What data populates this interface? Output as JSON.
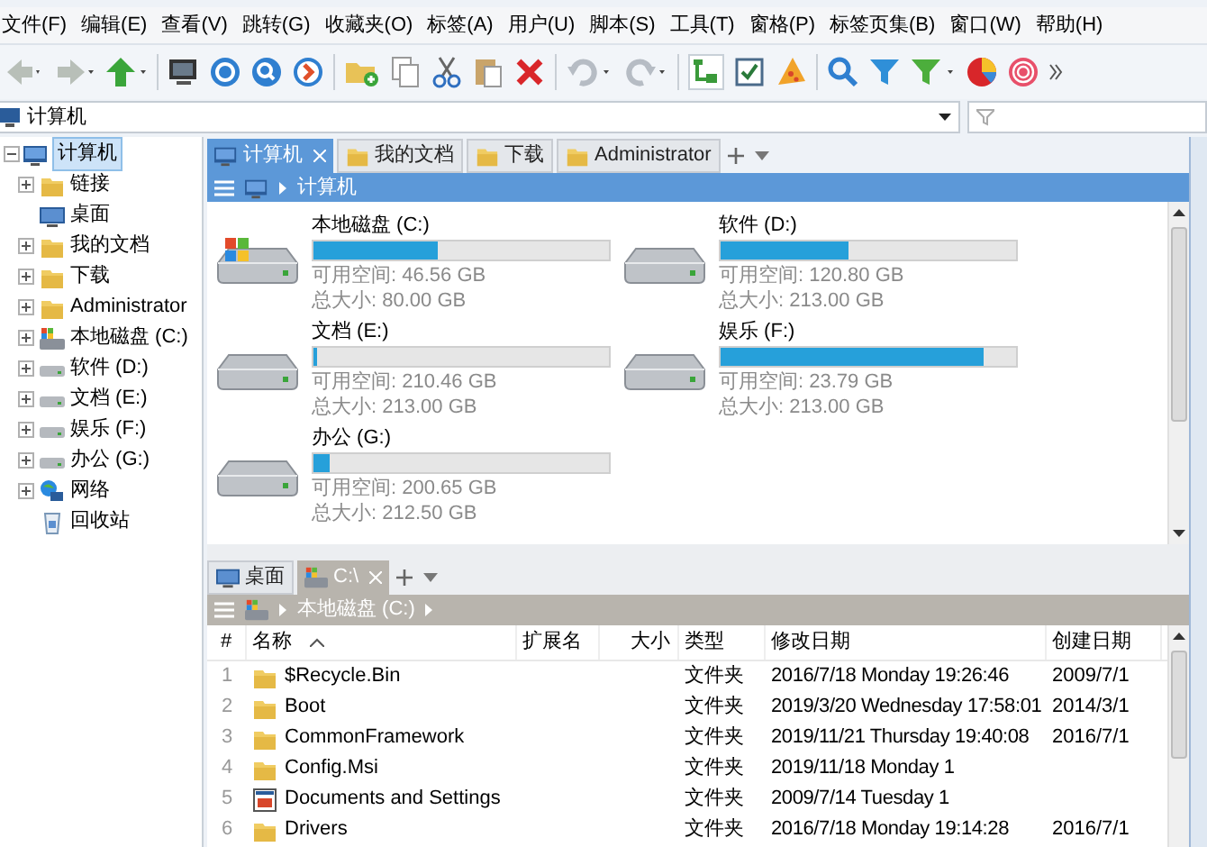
{
  "menu": [
    "文件(F)",
    "编辑(E)",
    "查看(V)",
    "跳转(G)",
    "收藏夹(O)",
    "标签(A)",
    "用户(U)",
    "脚本(S)",
    "工具(T)",
    "窗格(P)",
    "标签页集(B)",
    "窗口(W)",
    "帮助(H)"
  ],
  "address": {
    "value": "计算机"
  },
  "tree": {
    "label": "计算机",
    "selected": true,
    "expanded": true,
    "children": [
      {
        "label": "链接",
        "kind": "folder",
        "expandable": true
      },
      {
        "label": "桌面",
        "kind": "desktop",
        "expandable": false
      },
      {
        "label": "我的文档",
        "kind": "folder",
        "expandable": true
      },
      {
        "label": "下载",
        "kind": "folder",
        "expandable": true
      },
      {
        "label": "Administrator",
        "kind": "folder",
        "expandable": true
      },
      {
        "label": "本地磁盘 (C:)",
        "kind": "sysdrive",
        "expandable": true
      },
      {
        "label": "软件 (D:)",
        "kind": "drive",
        "expandable": true
      },
      {
        "label": "文档 (E:)",
        "kind": "drive",
        "expandable": true
      },
      {
        "label": "娱乐 (F:)",
        "kind": "drive",
        "expandable": true
      },
      {
        "label": "办公 (G:)",
        "kind": "drive",
        "expandable": true
      },
      {
        "label": "网络",
        "kind": "network",
        "expandable": true
      },
      {
        "label": "回收站",
        "kind": "bin",
        "expandable": false
      }
    ]
  },
  "top_pane": {
    "tabs": [
      {
        "label": "计算机",
        "kind": "computer",
        "selected": true
      },
      {
        "label": "我的文档",
        "kind": "folder",
        "selected": false
      },
      {
        "label": "下载",
        "kind": "folder",
        "selected": false
      },
      {
        "label": "Administrator",
        "kind": "folder",
        "selected": false
      }
    ],
    "breadcrumb": [
      "计算机"
    ],
    "drives": [
      {
        "name": "本地磁盘 (C:)",
        "kind": "sysdrive",
        "level": 0.42,
        "free": "可用空间: 46.56 GB",
        "total": "总大小: 80.00 GB"
      },
      {
        "name": "软件 (D:)",
        "kind": "drive",
        "level": 0.43,
        "free": "可用空间: 120.80 GB",
        "total": "总大小: 213.00 GB"
      },
      {
        "name": "文档 (E:)",
        "kind": "drive",
        "level": 0.012,
        "free": "可用空间: 210.46 GB",
        "total": "总大小: 213.00 GB"
      },
      {
        "name": "娱乐 (F:)",
        "kind": "drive",
        "level": 0.89,
        "free": "可用空间: 23.79 GB",
        "total": "总大小: 213.00 GB"
      },
      {
        "name": "办公 (G:)",
        "kind": "drive",
        "level": 0.056,
        "free": "可用空间: 200.65 GB",
        "total": "总大小: 212.50 GB"
      }
    ]
  },
  "bottom_pane": {
    "tabs": [
      {
        "label": "桌面",
        "kind": "desktop",
        "selected": false
      },
      {
        "label": "C:\\",
        "kind": "sysdrive",
        "selected": true
      }
    ],
    "breadcrumb": [
      "本地磁盘 (C:)"
    ],
    "columns": [
      "#",
      "名称",
      "扩展名",
      "大小",
      "类型",
      "修改日期",
      "创建日期"
    ],
    "rows": [
      {
        "index": "1",
        "name": "$Recycle.Bin",
        "kind": "folder",
        "type": "文件夹",
        "modified": "2016/7/18 Monday 19:26:46",
        "created": "2009/7/1"
      },
      {
        "index": "2",
        "name": "Boot",
        "kind": "folder",
        "type": "文件夹",
        "modified": "2019/3/20 Wednesday 17:58:01",
        "created": "2014/3/1"
      },
      {
        "index": "3",
        "name": "CommonFramework",
        "kind": "folder",
        "type": "文件夹",
        "modified": "2019/11/21 Thursday 19:40:08",
        "created": "2016/7/1"
      },
      {
        "index": "4",
        "name": "Config.Msi",
        "kind": "folder",
        "type": "文件夹",
        "modified": "2019/11/18 Monday 1"
      },
      {
        "index": "5",
        "name": "Documents and Settings",
        "kind": "link",
        "type": "文件夹",
        "modified": "2009/7/14 Tuesday 1"
      },
      {
        "index": "6",
        "name": "Drivers",
        "kind": "folder",
        "type": "文件夹",
        "modified": "2016/7/18 Monday 19:14:28",
        "created": "2016/7/1"
      }
    ]
  }
}
